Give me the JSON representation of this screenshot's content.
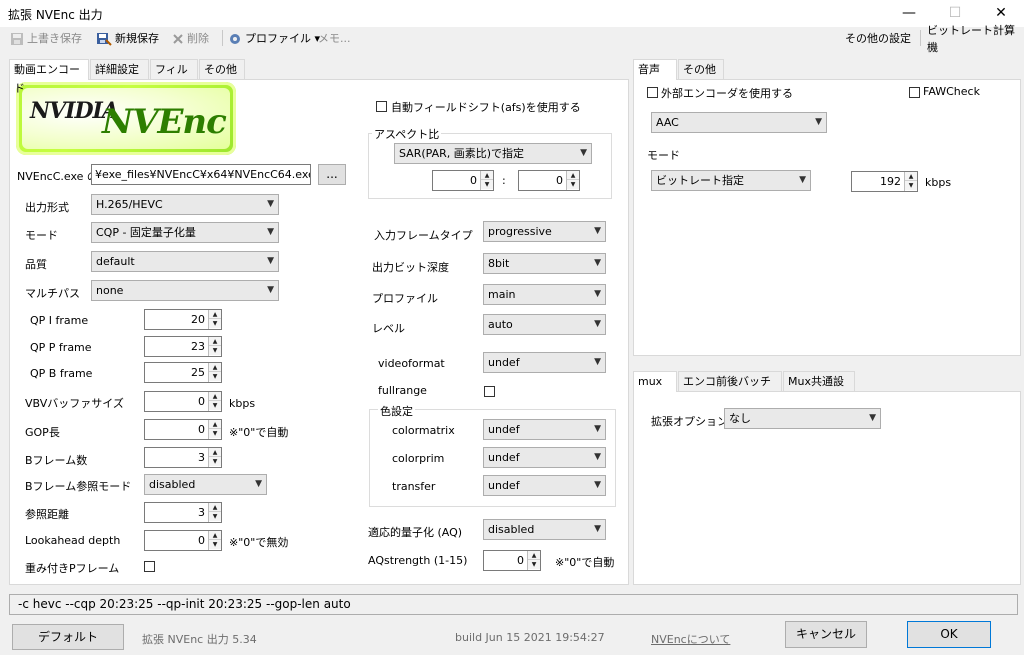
{
  "window": {
    "title": "拡張 NVEnc 出力",
    "minimize": "—",
    "maximize": "☐",
    "close": "✕"
  },
  "toolbar": {
    "overwrite_save": "上書き保存",
    "new_save": "新規保存",
    "delete": "削除",
    "profile": "プロファイル ▾",
    "memo": "メモ...",
    "other_settings": "その他の設定",
    "bitrate_calc": "ビットレート計算機"
  },
  "left_tabs": [
    "動画エンコード",
    "詳細設定",
    "フィルタ",
    "その他"
  ],
  "logo": {
    "text_small": "NVIDIA",
    "text_large": "NVEnc"
  },
  "exe": {
    "label": "NVEncC.exe の",
    "path": "¥exe_files¥NVEncC¥x64¥NVEncC64.exe",
    "browse": "..."
  },
  "video": {
    "output_format_label": "出力形式",
    "output_format": "H.265/HEVC",
    "mode_label": "モード",
    "mode": "CQP - 固定量子化量",
    "quality_label": "品質",
    "quality": "default",
    "multipass_label": "マルチパス",
    "multipass": "none",
    "qp_i_label": "QP I frame",
    "qp_i": "20",
    "qp_p_label": "QP P frame",
    "qp_p": "23",
    "qp_b_label": "QP B frame",
    "qp_b": "25",
    "vbv_label": "VBVバッファサイズ",
    "vbv": "0",
    "vbv_unit": "kbps",
    "gop_label": "GOP長",
    "gop": "0",
    "gop_hint": "※\"0\"で自動",
    "bframes_label": "Bフレーム数",
    "bframes": "3",
    "bref_label": "Bフレーム参照モード",
    "bref": "disabled",
    "ref_label": "参照距離",
    "ref": "3",
    "lookahead_label": "Lookahead depth",
    "lookahead": "0",
    "lookahead_hint": "※\"0\"で無効",
    "weightp_label": "重み付きPフレーム"
  },
  "middle": {
    "afs_label": "自動フィールドシフト(afs)を使用する",
    "aspect_title": "アスペクト比",
    "aspect_mode": "SAR(PAR, 画素比)で指定",
    "aspect_w": "0",
    "aspect_colon": ":",
    "aspect_h": "0",
    "input_frame_label": "入力フレームタイプ",
    "input_frame": "progressive",
    "bitdepth_label": "出力ビット深度",
    "bitdepth": "8bit",
    "profile_label": "プロファイル",
    "profile": "main",
    "level_label": "レベル",
    "level": "auto",
    "videoformat_label": "videoformat",
    "videoformat": "undef",
    "fullrange_label": "fullrange",
    "color_title": "色設定",
    "colormatrix_label": "colormatrix",
    "colormatrix": "undef",
    "colorprim_label": "colorprim",
    "colorprim": "undef",
    "transfer_label": "transfer",
    "transfer": "undef",
    "aq_label": "適応的量子化 (AQ)",
    "aq": "disabled",
    "aqstrength_label": "AQstrength (1-15)",
    "aqstrength": "0",
    "aqstrength_hint": "※\"0\"で自動"
  },
  "audio_tabs": [
    "音声",
    "その他"
  ],
  "audio": {
    "external_encoder_label": "外部エンコーダを使用する",
    "faw_label": "FAWCheck",
    "codec": "AAC",
    "mode_label": "モード",
    "mode": "ビットレート指定",
    "bitrate": "192",
    "bitrate_unit": "kbps"
  },
  "mux_tabs": [
    "mux",
    "エンコ前後バッチ処理",
    "Mux共通設定"
  ],
  "mux": {
    "ext_option_label": "拡張オプション",
    "ext_option": "なし"
  },
  "cmdline": "-c hevc --cqp 20:23:25 --qp-init 20:23:25 --gop-len auto",
  "footer": {
    "default_button": "デフォルト",
    "app_name": "拡張 NVEnc 出力 5.34",
    "build": "build Jun 15 2021 19:54:27",
    "about_link": "NVEncについて",
    "cancel_button": "キャンセル",
    "ok_button": "OK"
  }
}
